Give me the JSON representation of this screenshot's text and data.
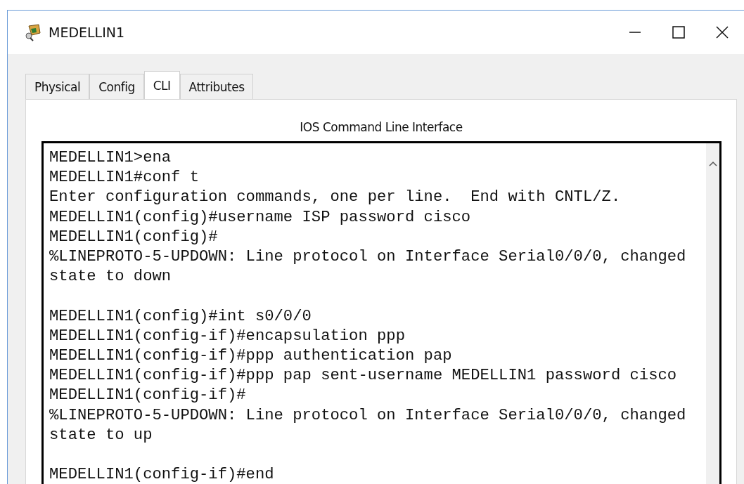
{
  "window": {
    "title": "MEDELLIN1"
  },
  "tabs": [
    {
      "label": "Physical",
      "selected": false
    },
    {
      "label": "Config",
      "selected": false
    },
    {
      "label": "CLI",
      "selected": true
    },
    {
      "label": "Attributes",
      "selected": false
    }
  ],
  "panel": {
    "heading": "IOS Command Line Interface"
  },
  "terminal": {
    "blocks": [
      {
        "lines": [
          "MEDELLIN1>ena",
          "MEDELLIN1#conf t",
          "Enter configuration commands, one per line.  End with CNTL/Z.",
          "MEDELLIN1(config)#username ISP password cisco",
          "MEDELLIN1(config)#",
          "%LINEPROTO-5-UPDOWN: Line protocol on Interface Serial0/0/0, changed state to down"
        ]
      },
      {
        "lines": [
          "MEDELLIN1(config)#int s0/0/0",
          "MEDELLIN1(config-if)#encapsulation ppp",
          "MEDELLIN1(config-if)#ppp authentication pap",
          "MEDELLIN1(config-if)#ppp pap sent-username MEDELLIN1 password cisco",
          "MEDELLIN1(config-if)#",
          "%LINEPROTO-5-UPDOWN: Line protocol on Interface Serial0/0/0, changed state to up"
        ]
      },
      {
        "lines": [
          "MEDELLIN1(config-if)#end"
        ]
      }
    ]
  }
}
